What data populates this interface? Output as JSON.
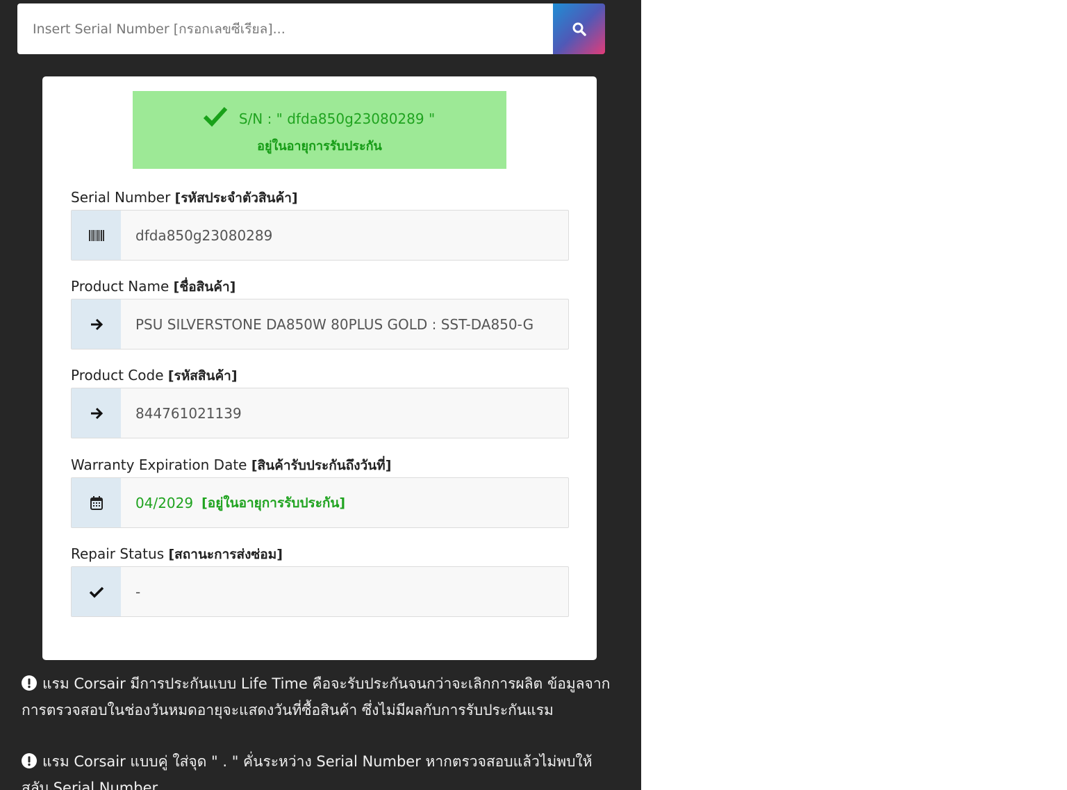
{
  "search": {
    "placeholder": "Insert Serial Number [กรอกเลขซีเรียล]..."
  },
  "result": {
    "sn_line": "S/N : \" dfda850g23080289 \"",
    "status_line": "อยู่ในอายุการรับประกัน"
  },
  "fields": {
    "serial": {
      "label": "Serial Number",
      "label_th": "[รหัสประจำตัวสินค้า]",
      "value": "dfda850g23080289"
    },
    "product_name": {
      "label": "Product Name",
      "label_th": "[ชื่อสินค้า]",
      "value": "PSU SILVERSTONE DA850W 80PLUS GOLD : SST-DA850-G"
    },
    "product_code": {
      "label": "Product Code",
      "label_th": "[รหัสสินค้า]",
      "value": "844761021139"
    },
    "warranty": {
      "label": "Warranty Expiration Date",
      "label_th": "[สินค้ารับประกันถึงวันที่]",
      "value": "04/2029",
      "status": "[อยู่ในอายุการรับประกัน]"
    },
    "repair": {
      "label": "Repair Status",
      "label_th": "[สถานะการส่งซ่อม]",
      "value": "-"
    }
  },
  "notes": [
    "แรม Corsair มีการประกันแบบ Life Time คือจะรับประกันจนกว่าจะเลิกการผลิต ข้อมูลจากการตรวจสอบในช่องวันหมดอายุจะแสดงวันที่ซื้อสินค้า ซึ่งไม่มีผลกับการรับประกันแรม",
    "แรม Corsair แบบคู่ ใส่จุด \" . \" คั่นระหว่าง Serial Number หากตรวจสอบแล้วไม่พบให้สลับ Serial Number"
  ],
  "colors": {
    "panel_bg": "#262626",
    "success_bg": "#9de996",
    "success_text": "#1fa31f",
    "addon_bg": "#dde9f2"
  },
  "icons": {
    "search": "search-icon",
    "check": "check-icon",
    "barcode": "barcode-icon",
    "arrow": "arrow-right-icon",
    "calendar": "calendar-icon",
    "info": "info-icon"
  }
}
